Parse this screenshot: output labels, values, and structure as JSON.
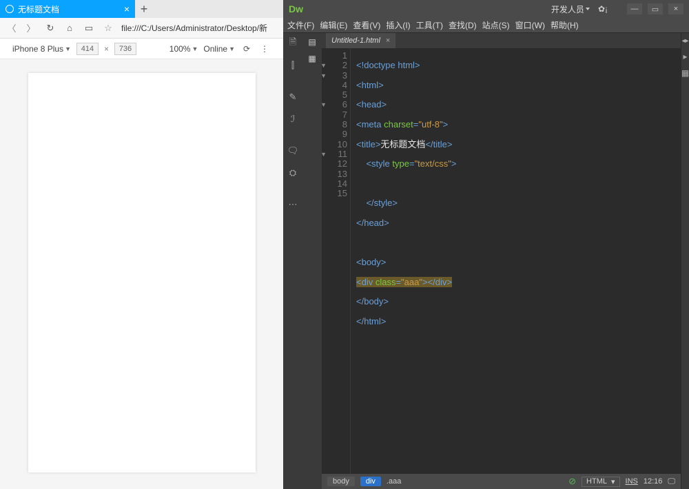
{
  "browser": {
    "tab_title": "无标题文档",
    "url": "file:///C:/Users/Administrator/Desktop/新",
    "device": "iPhone 8 Plus",
    "width": "414",
    "height": "736",
    "zoom": "100%",
    "online": "Online"
  },
  "dw": {
    "logo": "Dw",
    "workspace": "开发人员",
    "menus": [
      "文件(F)",
      "编辑(E)",
      "查看(V)",
      "插入(I)",
      "工具(T)",
      "查找(D)",
      "站点(S)",
      "窗口(W)",
      "帮助(H)"
    ],
    "file_tab": "Untitled-1.html",
    "gutter": {
      "lines": [
        "1",
        "2",
        "3",
        "4",
        "5",
        "6",
        "7",
        "8",
        "9",
        "10",
        "11",
        "12",
        "13",
        "14",
        "15"
      ],
      "folds": {
        "2": "▼",
        "3": "▼",
        "6": "▼",
        "11": "▼"
      }
    },
    "code": {
      "l1": {
        "a": "<!",
        "b": "doctype html",
        "c": ">"
      },
      "l2": {
        "a": "<",
        "b": "html",
        "c": ">"
      },
      "l3": {
        "a": "<",
        "b": "head",
        "c": ">"
      },
      "l4a": "<",
      "l4b": "meta",
      "l4c": " charset",
      "l4d": "=",
      "l4e": "\"utf-8\"",
      "l4f": ">",
      "l5a": "<",
      "l5b": "title",
      "l5c": ">",
      "l5d": "无标题文档",
      "l5e": "</",
      "l5f": "title",
      "l5g": ">",
      "l6a": "<",
      "l6b": "style",
      "l6c": " type",
      "l6d": "=",
      "l6e": "\"text/css\"",
      "l6f": ">",
      "l8a": "</",
      "l8b": "style",
      "l8c": ">",
      "l9a": "</",
      "l9b": "head",
      "l9c": ">",
      "l11a": "<",
      "l11b": "body",
      "l11c": ">",
      "l12a": "<",
      "l12b": "div",
      "l12c": " class",
      "l12d": "=",
      "l12e": "\"aaa\"",
      "l12f": ">",
      "l12g": "</",
      "l12h": "div",
      "l12i": ">",
      "l13a": "</",
      "l13b": "body",
      "l13c": ">",
      "l14a": "</",
      "l14b": "html",
      "l14c": ">"
    },
    "status": {
      "crumb1": "body",
      "crumb2": "div",
      "crumb3": ".aaa",
      "lang": "HTML",
      "ins": "INS",
      "time": "12:16"
    }
  }
}
